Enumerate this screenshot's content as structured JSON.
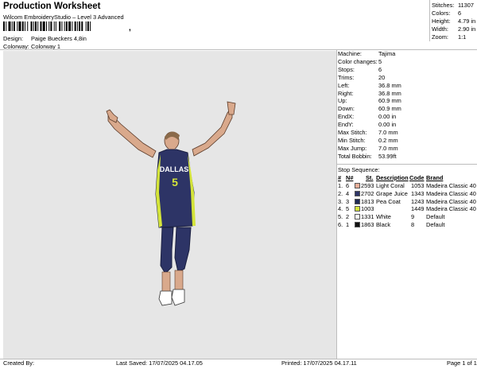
{
  "header": {
    "title": "Production Worksheet",
    "subtitle": "Wilcom EmbroideryStudio – Level 3 Advanced",
    "barcode_suffix": ","
  },
  "design_info": [
    {
      "label": "Design:",
      "value": "Paige Bueckers 4,8in"
    },
    {
      "label": "Colorway:",
      "value": "Colorway 1"
    }
  ],
  "summary": [
    {
      "label": "Stitches:",
      "value": "11307"
    },
    {
      "label": "Colors:",
      "value": "6"
    },
    {
      "label": "Height:",
      "value": "4.79 in"
    },
    {
      "label": "Width:",
      "value": "2.90 in"
    },
    {
      "label": "Zoom:",
      "value": "1:1"
    }
  ],
  "machine_info": [
    {
      "label": "Machine:",
      "value": "Tajima"
    },
    {
      "label": "Color changes:",
      "value": "5"
    },
    {
      "label": "Stops:",
      "value": "6"
    },
    {
      "label": "Trims:",
      "value": "20"
    },
    {
      "label": "Left:",
      "value": "36.8 mm"
    },
    {
      "label": "Right:",
      "value": "36.8 mm"
    },
    {
      "label": "Up:",
      "value": "60.9 mm"
    },
    {
      "label": "Down:",
      "value": "60.9 mm"
    },
    {
      "label": "EndX:",
      "value": "0.00 in"
    },
    {
      "label": "EndY:",
      "value": "0.00 in"
    },
    {
      "label": "Max Stitch:",
      "value": "7.0 mm"
    },
    {
      "label": "Min Stitch:",
      "value": "0.2 mm"
    },
    {
      "label": "Max Jump:",
      "value": "7.0 mm"
    },
    {
      "label": "Total Bobbin:",
      "value": "53.99ft"
    }
  ],
  "stop_sequence": {
    "title": "Stop Sequence:",
    "headers": [
      "#",
      "N#",
      "St.",
      "Description",
      "Code",
      "Brand"
    ],
    "rows": [
      {
        "num": "1.",
        "needle": "6",
        "color": "#e8ae98",
        "stitches": "2593",
        "description": "Light Coral",
        "code": "1053",
        "brand": "Madeira Classic 40"
      },
      {
        "num": "2.",
        "needle": "4",
        "color": "#2d3466",
        "stitches": "2702",
        "description": "Grape Juice",
        "code": "1343",
        "brand": "Madeira Classic 40"
      },
      {
        "num": "3.",
        "needle": "3",
        "color": "#1f2a55",
        "stitches": "1813",
        "description": "Pea Coat",
        "code": "1243",
        "brand": "Madeira Classic 40"
      },
      {
        "num": "4.",
        "needle": "5",
        "color": "#d4e43a",
        "stitches": "1003",
        "description": "",
        "code": "1449",
        "brand": "Madeira Classic 40"
      },
      {
        "num": "5.",
        "needle": "2",
        "color": "#ffffff",
        "stitches": "1331",
        "description": "White",
        "code": "9",
        "brand": "Default"
      },
      {
        "num": "6.",
        "needle": "1",
        "color": "#111111",
        "stitches": "1863",
        "description": "Black",
        "code": "8",
        "brand": "Default"
      }
    ]
  },
  "jersey": {
    "team": "DALLAS",
    "number": "5"
  },
  "footer": {
    "created_by": "Created By:",
    "last_saved": "Last Saved: 17/07/2025 04.17.05",
    "printed": "Printed: 17/07/2025 04.17.11",
    "page": "Page 1 of 1"
  }
}
